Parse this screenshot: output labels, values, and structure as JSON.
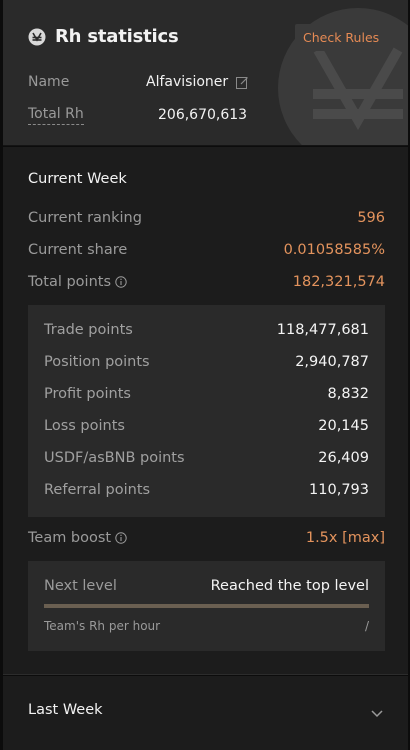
{
  "header": {
    "title": "Rh statistics",
    "check_rules_label": "Check Rules",
    "name_label": "Name",
    "name_value": "Alfavisioner",
    "total_label": "Total Rh",
    "total_value": "206,670,613"
  },
  "current_week": {
    "title": "Current Week",
    "ranking_label": "Current ranking",
    "ranking_value": "596",
    "share_label": "Current share",
    "share_value": "0.01058585%",
    "total_points_label": "Total points",
    "total_points_value": "182,321,574",
    "points": [
      {
        "label": "Trade points",
        "value": "118,477,681"
      },
      {
        "label": "Position points",
        "value": "2,940,787"
      },
      {
        "label": "Profit points",
        "value": "8,832"
      },
      {
        "label": "Loss points",
        "value": "20,145"
      },
      {
        "label": "USDF/asBNB points",
        "value": "26,409"
      },
      {
        "label": "Referral points",
        "value": "110,793"
      }
    ],
    "team_boost_label": "Team boost",
    "team_boost_value": "1.5x [max]",
    "next_level_label": "Next level",
    "next_level_value": "Reached the top level",
    "level_progress": 1.0,
    "team_rh_label": "Team's Rh per hour",
    "team_rh_value": "/"
  },
  "last_week": {
    "label": "Last Week"
  },
  "colors": {
    "accent": "#e3935d",
    "header_bg": "#2a2a2a",
    "panel_bg": "#1c1c1c",
    "box_bg": "#2a2a2a"
  },
  "icons": {
    "title": "aster-logo-icon",
    "edit": "edit-icon",
    "info": "info-icon",
    "chevron": "chevron-down-icon"
  }
}
